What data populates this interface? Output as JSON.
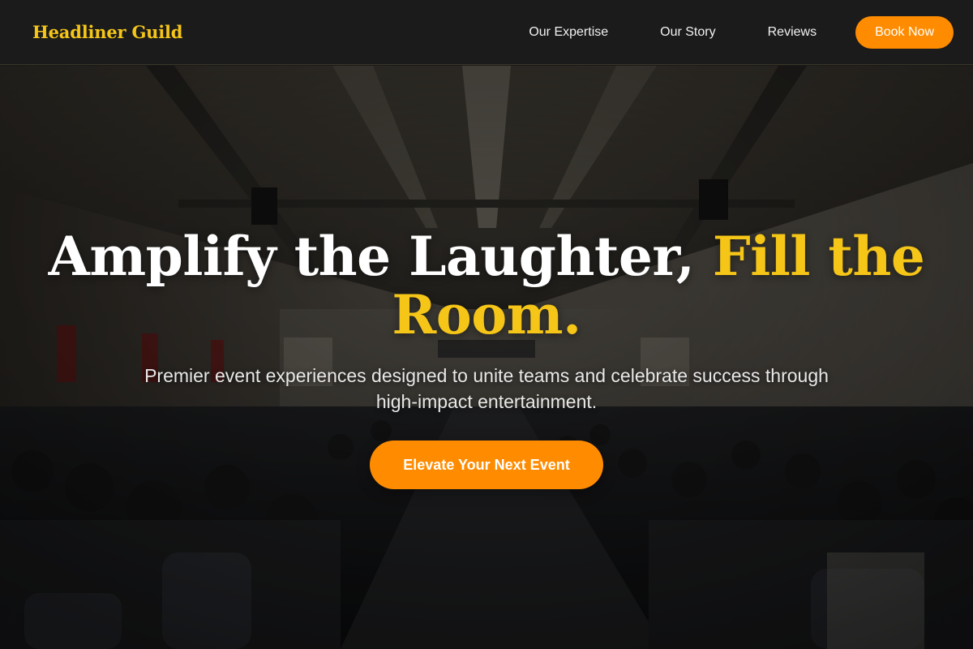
{
  "header": {
    "brand": "Headliner Guild",
    "nav": [
      {
        "label": "Our Expertise"
      },
      {
        "label": "Our Story"
      },
      {
        "label": "Reviews"
      }
    ],
    "cta_label": "Book Now"
  },
  "hero": {
    "title_part1": "Amplify the Laughter, ",
    "title_accent": "Fill the Room.",
    "subtitle": "Premier event experiences designed to unite teams and celebrate success through high-impact entertainment.",
    "cta_label": "Elevate Your Next Event",
    "background_icon": "conference-audience-photo"
  },
  "colors": {
    "accent_yellow": "#f5c518",
    "button_orange": "#ff8c00",
    "header_bg": "#1b1b1b"
  }
}
